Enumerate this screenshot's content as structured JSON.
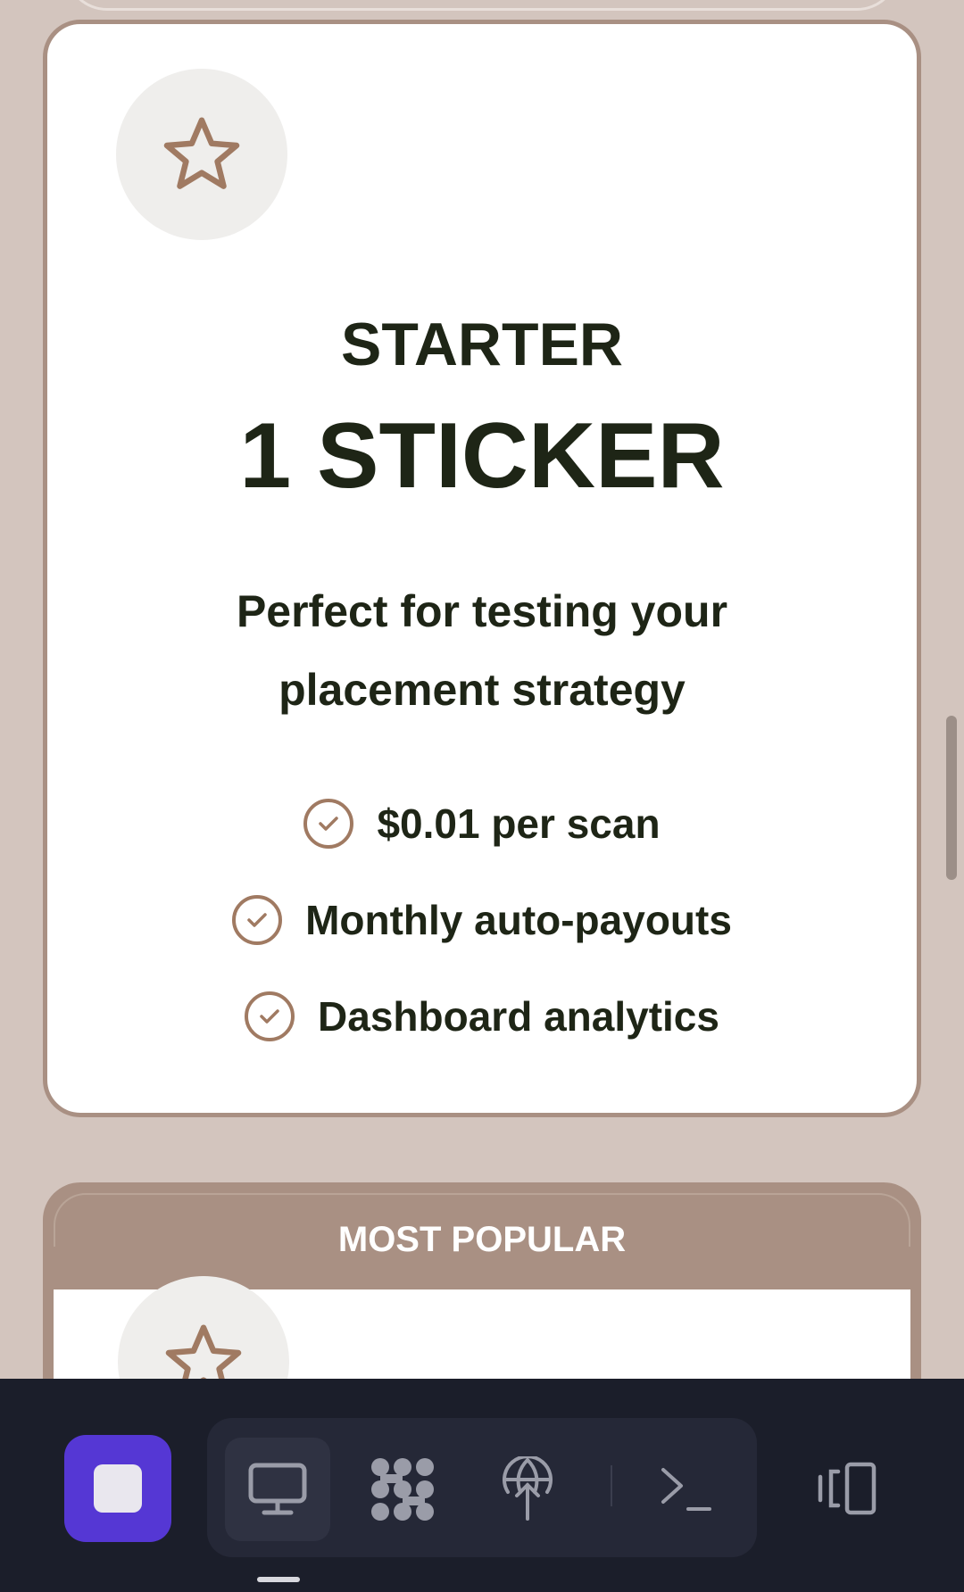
{
  "starter_plan": {
    "icon": "star-icon",
    "tier": "STARTER",
    "amount": "1 STICKER",
    "description": "Perfect for testing your placement strategy",
    "features": [
      "$0.01 per scan",
      "Monthly auto-payouts",
      "Dashboard analytics"
    ]
  },
  "popular_plan": {
    "badge": "MOST POPULAR",
    "icon": "star-icon"
  },
  "taskbar": {
    "start": "start-square-icon",
    "apps": [
      "desktop-monitor-icon",
      "apps-grid-icon",
      "network-globe-icon",
      "terminal-icon"
    ],
    "side": "device-switch-icon"
  },
  "colors": {
    "background": "#d3c5be",
    "card_border": "#a99083",
    "text": "#1e2516",
    "accent_brown": "#a07a62",
    "taskbar": "#1b1e2a",
    "start_button": "#5537d4"
  }
}
